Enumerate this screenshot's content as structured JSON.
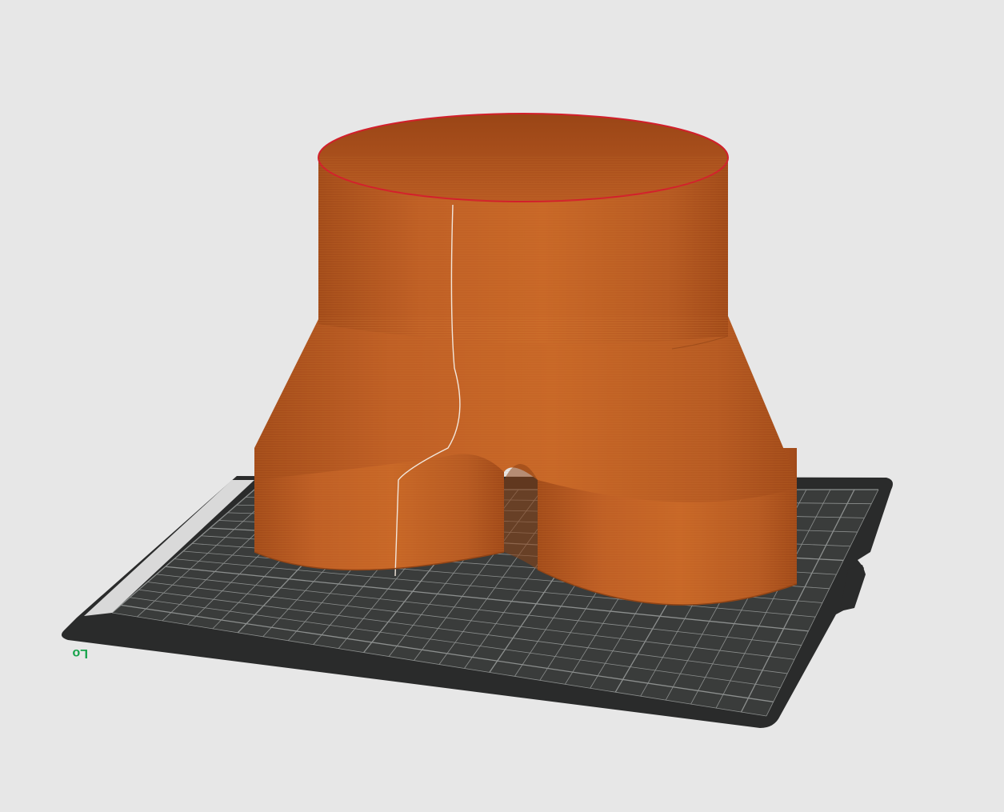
{
  "viewport": {
    "background_color": "#e7e7e7"
  },
  "build_plate": {
    "surface_color": "#3a3c3b",
    "grid_line_color": "#8c8f8e",
    "frame_color": "#2a2b2b",
    "label_strip_color": "#d9d9d9",
    "origin_label": "Lo",
    "origin_label_color": "#16a34a"
  },
  "model": {
    "name_icon": "y-splitter-model",
    "color": "#b95c23",
    "shadow_color": "#8e4316",
    "highlight_color": "#d9782f",
    "seam_color": "#f2e7dc",
    "rim_color": "#d21f2b"
  }
}
